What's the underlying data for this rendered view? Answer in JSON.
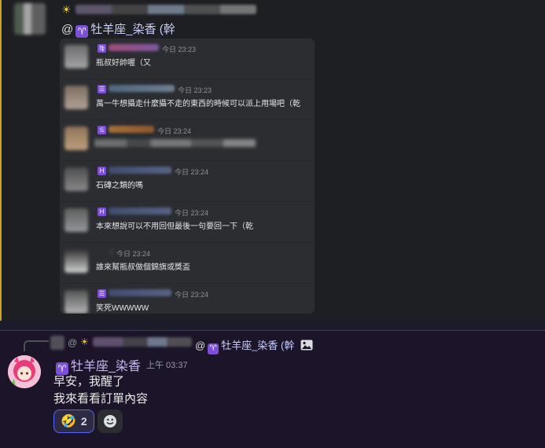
{
  "top_message": {
    "sun_icon": "☀",
    "mention_at": "@",
    "zodiac_glyph": "♈",
    "mention_name": "牡羊座_染香 (幹",
    "embed_rows": [
      {
        "badge": "♍",
        "time": "今日 23:23",
        "text": "瓶叔好帥喔（又"
      },
      {
        "badge": "☰",
        "time": "今日 23:23",
        "text": "萬一牛想攝走什麼攝不走的東西的時候可以派上用場吧（乾"
      },
      {
        "badge": "♋",
        "time": "今日 23:24",
        "text": ""
      },
      {
        "badge": "H",
        "time": "今日 23:24",
        "text": "石磚之類的嗎"
      },
      {
        "badge": "H",
        "time": "今日 23:24",
        "text": "本來想說可以不用回但最後一句要回一下（乾"
      },
      {
        "badge": "",
        "time": "今日 23:24",
        "text": "誰來幫瓶叔做個錦旗或獎盃"
      },
      {
        "badge": "☰",
        "time": "今日 23:24",
        "text": "笑死WWWWW"
      }
    ]
  },
  "bottom_message": {
    "reply_at": "@",
    "reply_sun": "☀",
    "reply_mention_at": "@",
    "reply_zodiac": "♈",
    "reply_name": "牡羊座_染香 (幹",
    "author_zodiac": "♈",
    "author_name": "牡羊座_染香",
    "timestamp": "上午 03:37",
    "line1": "早安，我醒了",
    "line2": "我來看看訂單內容",
    "reaction_emoji": "🤣",
    "reaction_count": "2",
    "add_reaction_icon": "smiley-add-icon"
  },
  "colors": {
    "accent": "#5865f2",
    "zodiac_badge": "#7b4fd6",
    "mention": "#c9cdfb",
    "highlight_border": "#c9a227"
  }
}
